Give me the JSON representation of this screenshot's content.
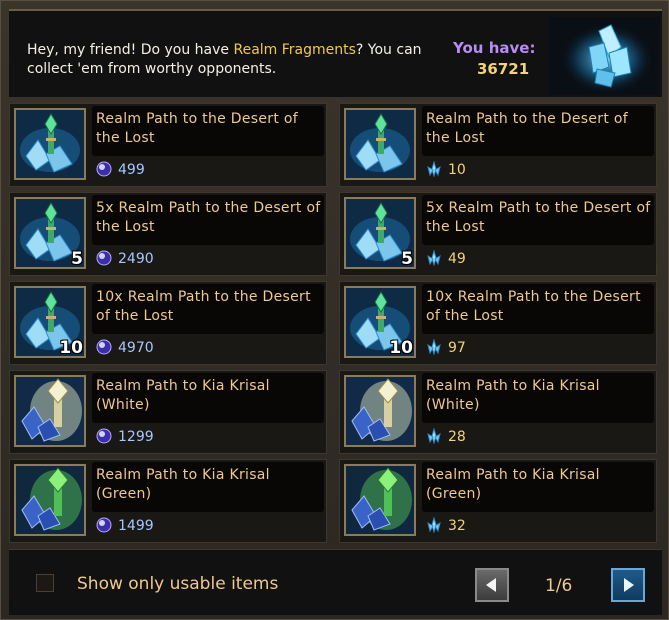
{
  "header": {
    "intro_prefix": "Hey, my friend! Do you have ",
    "intro_highlight": "Realm Fragments",
    "intro_suffix": "? You can collect 'em from worthy opponents.",
    "you_have_label": "You have:",
    "you_have_value": "36721",
    "crystal_icon": "realm-fragment-crystal-icon"
  },
  "colors": {
    "highlight": "#f0c94a",
    "you_have": "#b78df2",
    "item_name": "#efc98e",
    "orb_price": "#a8c6ff",
    "shard_price": "#f2d27a"
  },
  "items": [
    {
      "name": "Realm Path to the Desert of the Lost",
      "qty": "",
      "price": "499",
      "currency": "orb",
      "thumb": "desert"
    },
    {
      "name": "Realm Path to the Desert of the Lost",
      "qty": "",
      "price": "10",
      "currency": "shard",
      "thumb": "desert"
    },
    {
      "name": "5x Realm Path to the Desert of the Lost",
      "qty": "5",
      "price": "2490",
      "currency": "orb",
      "thumb": "desert"
    },
    {
      "name": "5x Realm Path to the Desert of the Lost",
      "qty": "5",
      "price": "49",
      "currency": "shard",
      "thumb": "desert"
    },
    {
      "name": "10x Realm Path to the Desert of the Lost",
      "qty": "10",
      "price": "4970",
      "currency": "orb",
      "thumb": "desert"
    },
    {
      "name": "10x Realm Path to the Desert of the Lost",
      "qty": "10",
      "price": "97",
      "currency": "shard",
      "thumb": "desert"
    },
    {
      "name": "Realm Path to Kia Krisal (White)",
      "qty": "",
      "price": "1299",
      "currency": "orb",
      "thumb": "white"
    },
    {
      "name": "Realm Path to Kia Krisal (White)",
      "qty": "",
      "price": "28",
      "currency": "shard",
      "thumb": "white"
    },
    {
      "name": "Realm Path to Kia Krisal (Green)",
      "qty": "",
      "price": "1499",
      "currency": "orb",
      "thumb": "green"
    },
    {
      "name": "Realm Path to Kia Krisal (Green)",
      "qty": "",
      "price": "32",
      "currency": "shard",
      "thumb": "green"
    }
  ],
  "footer": {
    "usable_label": "Show only usable items",
    "usable_checked": false,
    "page_indicator": "1/6",
    "prev_icon": "arrow-left-icon",
    "next_icon": "arrow-right-icon"
  }
}
